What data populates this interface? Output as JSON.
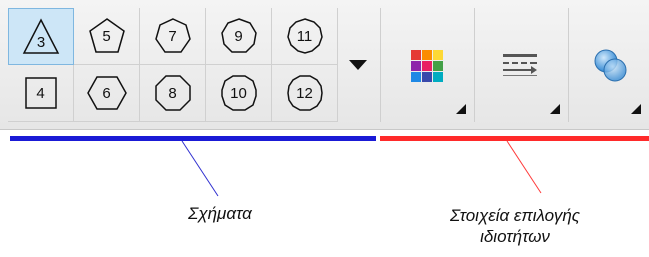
{
  "shapes": [
    {
      "label": "3",
      "icon": "triangle-icon",
      "selected": true
    },
    {
      "label": "5",
      "icon": "pentagon-icon"
    },
    {
      "label": "7",
      "icon": "heptagon-icon"
    },
    {
      "label": "9",
      "icon": "nonagon-icon"
    },
    {
      "label": "11",
      "icon": "hendecagon-icon"
    },
    {
      "label": "4",
      "icon": "square-icon"
    },
    {
      "label": "6",
      "icon": "hexagon-icon"
    },
    {
      "label": "8",
      "icon": "octagon-icon"
    },
    {
      "label": "10",
      "icon": "decagon-icon"
    },
    {
      "label": "12",
      "icon": "dodecagon-icon"
    }
  ],
  "toolbar": {
    "more_icon": "dropdown-arrow-icon",
    "fill_icon": "color-palette-icon",
    "line_icon": "line-style-icon",
    "transparency_icon": "transparency-icon"
  },
  "palette_colors": [
    "#e53935",
    "#fb8c00",
    "#fdd835",
    "#8e24aa",
    "#e91e63",
    "#43a047",
    "#1e88e5",
    "#3949ab",
    "#00acc1"
  ],
  "colors": {
    "selection_bg": "#cde6f7",
    "bar_shapes": "#1a1ad6",
    "bar_properties": "#ff2a2a"
  },
  "captions": {
    "shapes": "Σχήματα",
    "properties_line1": "Στοιχεία επιλογής",
    "properties_line2": "ιδιοτήτων"
  }
}
